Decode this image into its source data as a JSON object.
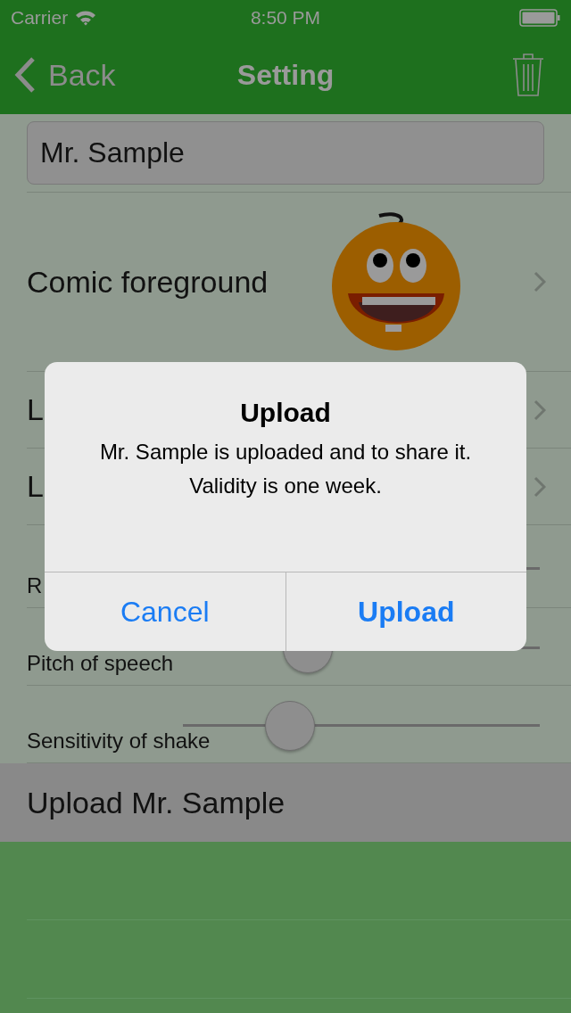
{
  "status_bar": {
    "carrier": "Carrier",
    "time": "8:50 PM"
  },
  "nav_bar": {
    "back": "Back",
    "title": "Setting"
  },
  "name_field": {
    "value": "Mr. Sample"
  },
  "rows": [
    {
      "kind": "image",
      "label": "Comic foreground"
    },
    {
      "kind": "detail",
      "label": "L"
    },
    {
      "kind": "detail",
      "label": "L"
    },
    {
      "kind": "slider",
      "label": "R"
    },
    {
      "kind": "slider",
      "label": "Pitch of speech",
      "level": 0.35
    },
    {
      "kind": "slider",
      "label": "Sensitivity of shake",
      "level": 0.3
    }
  ],
  "action": {
    "label": "Upload Mr. Sample"
  },
  "dialog": {
    "title": "Upload",
    "message": "Mr. Sample is uploaded and to share it.\nValidity is one week.",
    "buttons": [
      {
        "kind": "cancel",
        "label": "Cancel"
      },
      {
        "kind": "default",
        "label": "Upload"
      }
    ]
  }
}
